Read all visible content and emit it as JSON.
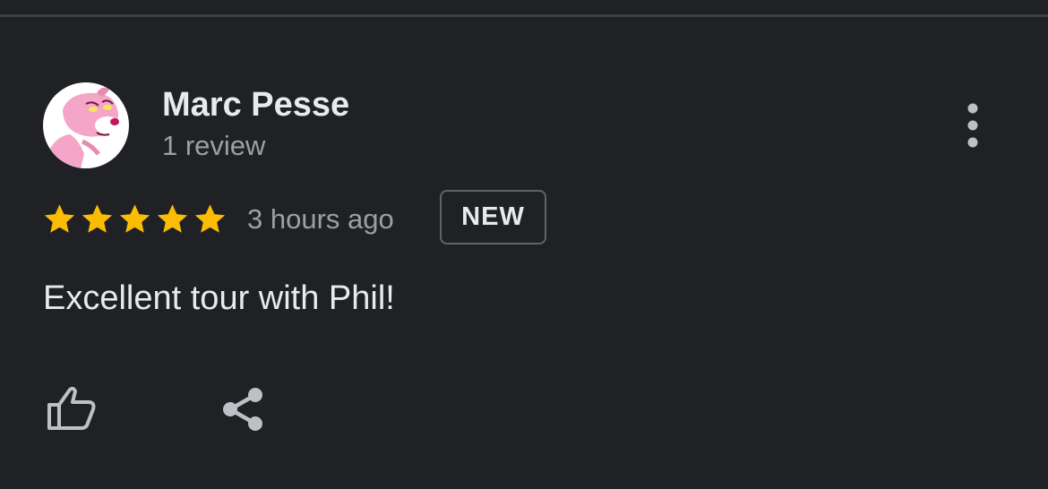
{
  "review": {
    "author_name": "Marc Pesse",
    "review_count": "1 review",
    "rating": 5,
    "rating_max": 5,
    "timestamp": "3 hours ago",
    "badge": "NEW",
    "text": "Excellent tour with Phil!"
  },
  "icons": {
    "avatar": "pink-panther-avatar",
    "more": "more-vertical-icon",
    "star": "star-icon",
    "like": "thumbs-up-icon",
    "share": "share-icon"
  },
  "colors": {
    "background": "#202124",
    "primary_text": "#e8eaed",
    "secondary_text": "#9aa0a6",
    "star": "#fbbc04",
    "icon": "#bdc1c6",
    "badge_border": "#5f6368",
    "divider": "#3c4043"
  }
}
